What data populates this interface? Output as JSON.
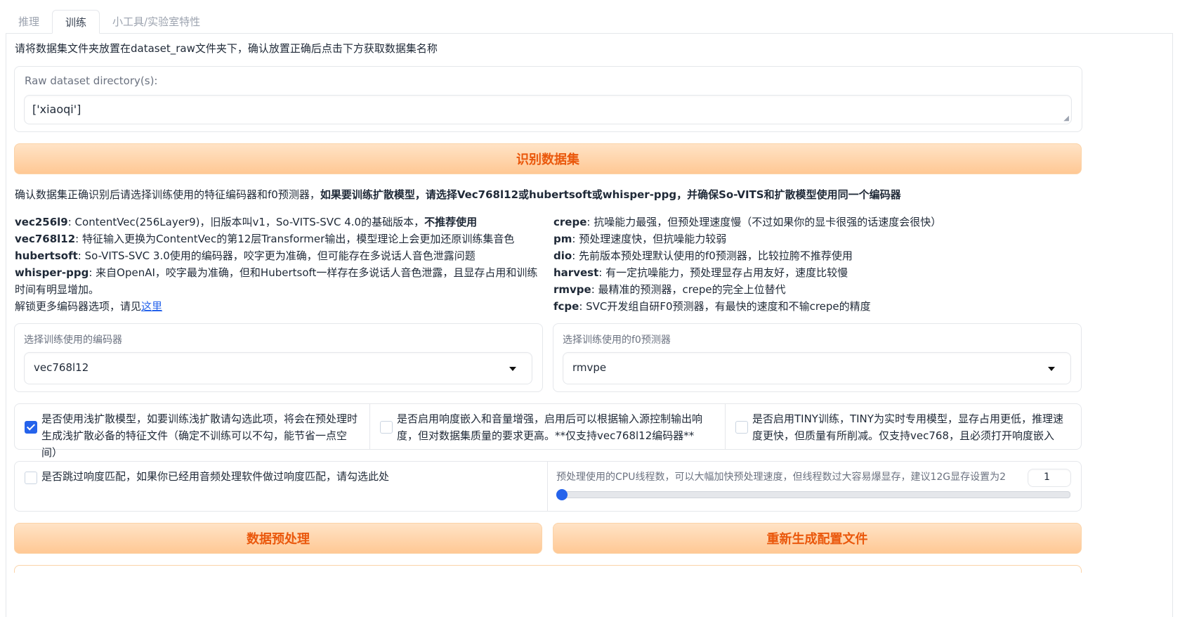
{
  "tabs": [
    "推理",
    "训练",
    "小工具/实验室特性"
  ],
  "intro_text": "请将数据集文件夹放置在dataset_raw文件夹下，确认放置正确后点击下方获取数据集名称",
  "raw_dir": {
    "label": "Raw dataset directory(s):",
    "value": "['xiaoqi']"
  },
  "identify_button": "识别数据集",
  "confirm_text_normal": "确认数据集正确识别后请选择训练使用的特征编码器和f0预测器，",
  "confirm_text_bold": "如果要训练扩散模型，请选择Vec768l12或hubertsoft或whisper-ppg，并确保So-VITS和扩散模型使用同一个编码器",
  "encoders_info": [
    {
      "name": "vec256l9",
      "desc": ": ContentVec(256Layer9)，旧版本叫v1，So-VITS-SVC 4.0的基础版本，",
      "bold_tail": "不推荐使用"
    },
    {
      "name": "vec768l12",
      "desc": ": 特征输入更换为ContentVec的第12层Transformer输出，模型理论上会更加还原训练集音色",
      "bold_tail": ""
    },
    {
      "name": "hubertsoft",
      "desc": ": So-VITS-SVC 3.0使用的编码器，咬字更为准确，但可能存在多说话人音色泄露问题",
      "bold_tail": ""
    },
    {
      "name": "whisper-ppg",
      "desc": ": 来自OpenAI，咬字最为准确，但和Hubertsoft一样存在多说话人音色泄露，且显存占用和训练时间有明显增加。",
      "bold_tail": ""
    }
  ],
  "unlock_text": "解锁更多编码器选项，请见",
  "unlock_link": "这里",
  "f0_info": [
    {
      "name": "crepe",
      "desc": ": 抗噪能力最强，但预处理速度慢（不过如果你的显卡很强的话速度会很快）"
    },
    {
      "name": "pm",
      "desc": ": 预处理速度快，但抗噪能力较弱"
    },
    {
      "name": "dio",
      "desc": ": 先前版本预处理默认使用的f0预测器，比较拉胯不推荐使用"
    },
    {
      "name": "harvest",
      "desc": ": 有一定抗噪能力，预处理显存占用友好，速度比较慢"
    },
    {
      "name": "rmvpe",
      "desc": ": 最精准的预测器，crepe的完全上位替代"
    },
    {
      "name": "fcpe",
      "desc": ": SVC开发组自研F0预测器，有最快的速度和不输crepe的精度"
    }
  ],
  "encoder_select": {
    "label": "选择训练使用的编码器",
    "value": "vec768l12"
  },
  "f0_select": {
    "label": "选择训练使用的f0预测器",
    "value": "rmvpe"
  },
  "checkboxes": [
    {
      "text": "是否使用浅扩散模型，如要训练浅扩散请勾选此项，将会在预处理时生成浅扩散必备的特征文件（确定不训练可以不勾，能节省一点空间）",
      "checked": true
    },
    {
      "text": "是否启用响度嵌入和音量增强，启用后可以根据输入源控制输出响度，但对数据集质量的要求更高。**仅支持vec768l12编码器**",
      "checked": false
    },
    {
      "text": "是否启用TINY训练，TINY为实时专用模型，显存占用更低，推理速度更快，但质量有所削减。仅支持vec768，且必须打开响度嵌入",
      "checked": false
    }
  ],
  "skip_loudness": {
    "text": "是否跳过响度匹配，如果你已经用音频处理软件做过响度匹配，请勾选此处",
    "checked": false
  },
  "cpu_threads": {
    "label": "预处理使用的CPU线程数，可以大幅加快预处理速度，但线程数过大容易爆显存，建议12G显存设置为2",
    "value": "1",
    "slider_fraction": 0.0
  },
  "preprocess_button": "数据预处理",
  "regen_config_button": "重新生成配置文件",
  "colors": {
    "accent_orange": "#ea580c",
    "checkbox_blue": "#2563eb"
  }
}
